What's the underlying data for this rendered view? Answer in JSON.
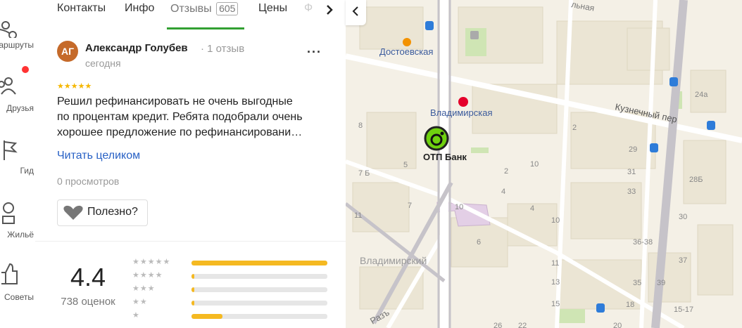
{
  "sidebar": {
    "items": [
      {
        "label": "Маршруты",
        "icon": "routes-icon"
      },
      {
        "label": "Друзья",
        "icon": "friends-icon"
      },
      {
        "label": "Гид",
        "icon": "flag-icon"
      },
      {
        "label": "Жильё",
        "icon": "housing-icon"
      },
      {
        "label": "Советы",
        "icon": "thumbs-up-icon"
      }
    ]
  },
  "tabs": [
    {
      "label": "Контакты"
    },
    {
      "label": "Инфо"
    },
    {
      "label": "Отзывы",
      "count": "605",
      "active": true
    },
    {
      "label": "Цены"
    },
    {
      "label": "Ф"
    }
  ],
  "review": {
    "avatar_initials": "АГ",
    "author": "Александр Голубев",
    "author_meta": "· 1 отзыв",
    "date": "сегодня",
    "stars": 5,
    "text_lines": [
      "Решил рефинансировать не очень выгодные",
      "по процентам кредит. Ребята подобрали очень",
      "хорошее предложение по рефинансировани…"
    ],
    "read_more": "Читать целиком",
    "views": "0 просмотров",
    "useful_label": "Полезно?"
  },
  "rating": {
    "average": "4.4",
    "count_label": "738 оценок",
    "distribution": [
      {
        "stars": 5,
        "fraction": 1.0
      },
      {
        "stars": 4,
        "fraction": 0.02
      },
      {
        "stars": 3,
        "fraction": 0.02
      },
      {
        "stars": 2,
        "fraction": 0.02
      },
      {
        "stars": 1,
        "fraction": 0.23
      }
    ]
  },
  "map": {
    "labels": {
      "metro_1": "Достоевская",
      "metro_2": "Владимирская",
      "bank": "ОТП Банк",
      "street_1": "Кузнечный пер",
      "street_2": "Владимирский",
      "street_3": "Разъ",
      "street_top": "льная"
    },
    "house_numbers": [
      "8",
      "7 Б",
      "5",
      "7",
      "11",
      "10",
      "6",
      "4",
      "2",
      "10",
      "11",
      "13",
      "15",
      "2",
      "29",
      "31",
      "33",
      "24а",
      "28Б",
      "30",
      "36-38",
      "35",
      "37",
      "39",
      "15-17",
      "18",
      "20",
      "22",
      "26",
      "10",
      "4"
    ]
  },
  "colors": {
    "accent_green": "#32a032",
    "star_yellow": "#f5b700",
    "link_blue": "#2861c5",
    "bar_yellow": "#f5b921"
  }
}
